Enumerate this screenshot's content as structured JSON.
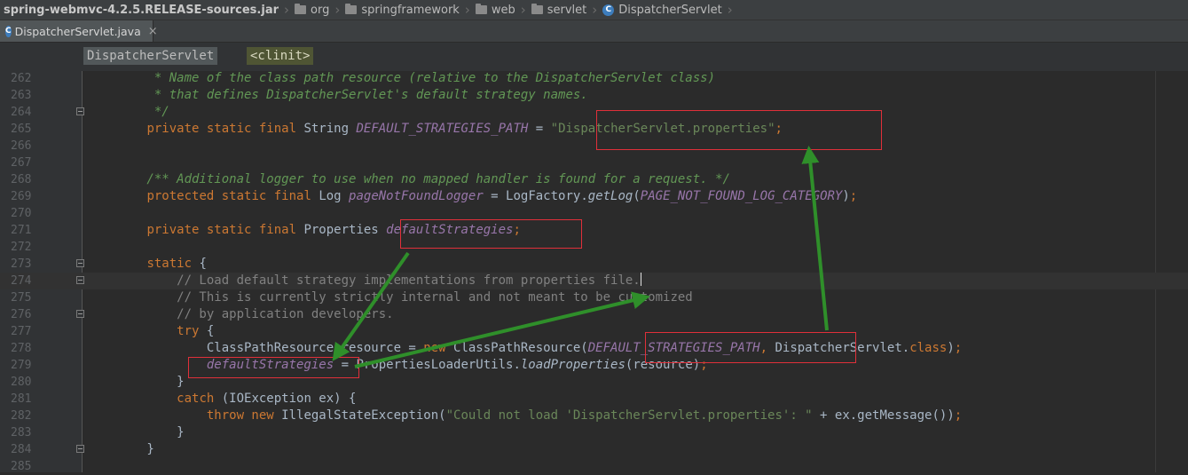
{
  "breadcrumb": {
    "items": [
      "spring-webmvc-4.2.5.RELEASE-sources.jar",
      "org",
      "springframework",
      "web",
      "servlet",
      "DispatcherServlet"
    ],
    "class_icon_letter": "C"
  },
  "tab": {
    "label": "DispatcherServlet.java",
    "close": "×"
  },
  "nav": {
    "class_name": "DispatcherServlet",
    "member": "<clinit>"
  },
  "editor": {
    "lines": [
      {
        "n": "262",
        "fold": false,
        "parts": [
          {
            "t": "         * Name of the class path resource (relative to the DispatcherServlet class)",
            "c": "doc"
          }
        ]
      },
      {
        "n": "263",
        "fold": false,
        "parts": [
          {
            "t": "         * that defines DispatcherServlet's default strategy names.",
            "c": "doc"
          }
        ]
      },
      {
        "n": "264",
        "fold": true,
        "parts": [
          {
            "t": "         */",
            "c": "doc"
          }
        ]
      },
      {
        "n": "265",
        "fold": false,
        "parts": [
          {
            "t": "        ",
            "c": ""
          },
          {
            "t": "private static final ",
            "c": "kw"
          },
          {
            "t": "String ",
            "c": ""
          },
          {
            "t": "DEFAULT_STRATEGIES_PATH",
            "c": "fld"
          },
          {
            "t": " = ",
            "c": ""
          },
          {
            "t": "\"DispatcherServlet.properties\"",
            "c": "str"
          },
          {
            "t": ";",
            "c": "kw"
          }
        ]
      },
      {
        "n": "266",
        "fold": false,
        "parts": []
      },
      {
        "n": "267",
        "fold": false,
        "parts": []
      },
      {
        "n": "268",
        "fold": false,
        "parts": [
          {
            "t": "        /** Additional logger to use when no mapped handler is found for a request. */",
            "c": "doc"
          }
        ]
      },
      {
        "n": "269",
        "fold": false,
        "parts": [
          {
            "t": "        ",
            "c": ""
          },
          {
            "t": "protected static final ",
            "c": "kw"
          },
          {
            "t": "Log ",
            "c": ""
          },
          {
            "t": "pageNotFoundLogger",
            "c": "fld"
          },
          {
            "t": " = LogFactory.",
            "c": ""
          },
          {
            "t": "getLog",
            "c": "mth"
          },
          {
            "t": "(",
            "c": ""
          },
          {
            "t": "PAGE_NOT_FOUND_LOG_CATEGORY",
            "c": "fld"
          },
          {
            "t": ")",
            "c": ""
          },
          {
            "t": ";",
            "c": "kw"
          }
        ]
      },
      {
        "n": "270",
        "fold": false,
        "parts": []
      },
      {
        "n": "271",
        "fold": false,
        "parts": [
          {
            "t": "        ",
            "c": ""
          },
          {
            "t": "private static final ",
            "c": "kw"
          },
          {
            "t": "Properties ",
            "c": ""
          },
          {
            "t": "defaultStrategies",
            "c": "fld"
          },
          {
            "t": ";",
            "c": "kw"
          }
        ]
      },
      {
        "n": "272",
        "fold": false,
        "parts": []
      },
      {
        "n": "273",
        "fold": true,
        "parts": [
          {
            "t": "        ",
            "c": ""
          },
          {
            "t": "static ",
            "c": "kw"
          },
          {
            "t": "{",
            "c": ""
          }
        ]
      },
      {
        "n": "274",
        "fold": true,
        "current": true,
        "parts": [
          {
            "t": "            // Load default strategy implementations from properties file.",
            "c": "cm"
          },
          {
            "t": "",
            "c": "caret"
          }
        ]
      },
      {
        "n": "275",
        "fold": false,
        "parts": [
          {
            "t": "            // This is currently strictly internal and not meant to be customized",
            "c": "cm"
          }
        ]
      },
      {
        "n": "276",
        "fold": true,
        "parts": [
          {
            "t": "            // by application developers.",
            "c": "cm"
          }
        ]
      },
      {
        "n": "277",
        "fold": false,
        "parts": [
          {
            "t": "            ",
            "c": ""
          },
          {
            "t": "try ",
            "c": "kw"
          },
          {
            "t": "{",
            "c": ""
          }
        ]
      },
      {
        "n": "278",
        "fold": false,
        "parts": [
          {
            "t": "                ClassPathResource resource = ",
            "c": ""
          },
          {
            "t": "new ",
            "c": "kw"
          },
          {
            "t": "ClassPathResource(",
            "c": ""
          },
          {
            "t": "DEFAULT_STRATEGIES_PATH",
            "c": "fld"
          },
          {
            "t": ", ",
            "c": "kw"
          },
          {
            "t": "DispatcherServlet.",
            "c": ""
          },
          {
            "t": "class",
            "c": "kw"
          },
          {
            "t": ")",
            "c": ""
          },
          {
            "t": ";",
            "c": "kw"
          }
        ]
      },
      {
        "n": "279",
        "fold": false,
        "parts": [
          {
            "t": "                ",
            "c": ""
          },
          {
            "t": "defaultStrategies",
            "c": "fld"
          },
          {
            "t": " = PropertiesLoaderUtils.",
            "c": ""
          },
          {
            "t": "loadProperties",
            "c": "mth"
          },
          {
            "t": "(resource)",
            "c": ""
          },
          {
            "t": ";",
            "c": "kw"
          }
        ]
      },
      {
        "n": "280",
        "fold": false,
        "parts": [
          {
            "t": "            }",
            "c": ""
          }
        ]
      },
      {
        "n": "281",
        "fold": false,
        "parts": [
          {
            "t": "            ",
            "c": ""
          },
          {
            "t": "catch ",
            "c": "kw"
          },
          {
            "t": "(IOException ex) {",
            "c": ""
          }
        ]
      },
      {
        "n": "282",
        "fold": false,
        "parts": [
          {
            "t": "                ",
            "c": ""
          },
          {
            "t": "throw new ",
            "c": "kw"
          },
          {
            "t": "IllegalStateException(",
            "c": ""
          },
          {
            "t": "\"Could not load 'DispatcherServlet.properties': \"",
            "c": "str"
          },
          {
            "t": " + ex.getMessage())",
            "c": ""
          },
          {
            "t": ";",
            "c": "kw"
          }
        ]
      },
      {
        "n": "283",
        "fold": false,
        "parts": [
          {
            "t": "            }",
            "c": ""
          }
        ]
      },
      {
        "n": "284",
        "fold": true,
        "parts": [
          {
            "t": "        }",
            "c": ""
          }
        ]
      },
      {
        "n": "285",
        "fold": false,
        "parts": []
      }
    ]
  },
  "colors": {
    "annotation_box": "#e0303a",
    "annotation_arrow": "#2f8f2a"
  }
}
